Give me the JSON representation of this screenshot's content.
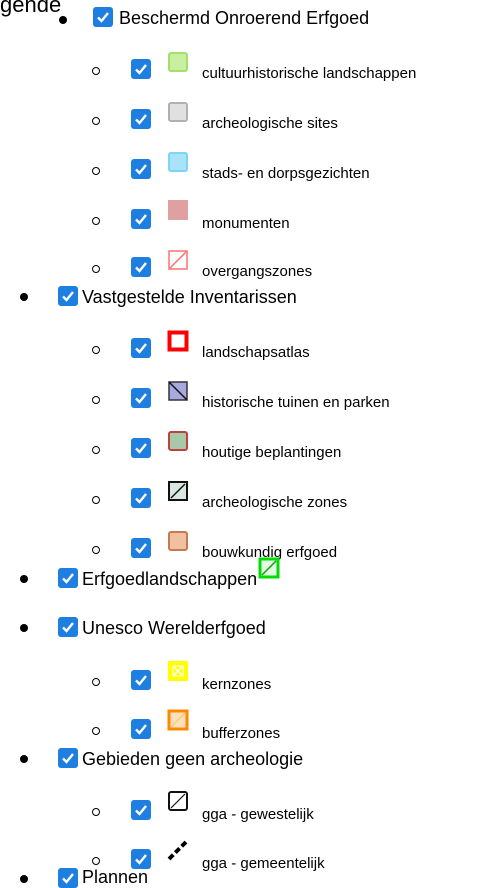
{
  "legend": {
    "title": "gende",
    "groups": [
      {
        "label": "Beschermd Onroerend Erfgoed",
        "checked": true,
        "items": [
          {
            "label": "cultuurhistorische landschappen",
            "checked": true,
            "icon": "light-green-square-icon"
          },
          {
            "label": "archeologische sites",
            "checked": true,
            "icon": "grey-square-icon"
          },
          {
            "label": "stads- en dorpsgezichten",
            "checked": true,
            "icon": "light-blue-square-icon"
          },
          {
            "label": "monumenten",
            "checked": true,
            "icon": "pink-square-icon"
          },
          {
            "label": "overgangszones",
            "checked": true,
            "icon": "red-hatched-square-icon"
          }
        ]
      },
      {
        "label": "Vastgestelde Inventarissen",
        "checked": true,
        "items": [
          {
            "label": "landschapsatlas",
            "checked": true,
            "icon": "red-outline-square-icon"
          },
          {
            "label": "historische tuinen en parken",
            "checked": true,
            "icon": "purple-hatched-square-icon"
          },
          {
            "label": "houtige beplantingen",
            "checked": true,
            "icon": "green-red-square-icon"
          },
          {
            "label": "archeologische zones",
            "checked": true,
            "icon": "black-hatched-square-icon"
          },
          {
            "label": "bouwkundig erfgoed",
            "checked": true,
            "icon": "orange-square-icon"
          }
        ]
      },
      {
        "label": "Erfgoedlandschappen",
        "checked": true,
        "icon": "green-hatched-square-icon",
        "items": []
      },
      {
        "label": "Unesco Werelderfgoed",
        "checked": true,
        "items": [
          {
            "label": "kernzones",
            "checked": true,
            "icon": "yellow-cross-square-icon"
          },
          {
            "label": "bufferzones",
            "checked": true,
            "icon": "orange-hatched-square-icon"
          }
        ]
      },
      {
        "label": "Gebieden geen archeologie",
        "checked": true,
        "items": [
          {
            "label": "gga - gewestelijk",
            "checked": true,
            "icon": "black-hatched-outline-icon"
          },
          {
            "label": "gga - gemeentelijk",
            "checked": true,
            "icon": "black-dashed-line-icon"
          }
        ]
      },
      {
        "label": "Plannen",
        "checked": true,
        "items": []
      }
    ]
  },
  "colors": {
    "checkbox": "#1e7fe0",
    "light_green": "#a3e06a",
    "grey": "#c8c8c8",
    "light_blue": "#7fd4f5",
    "pink": "#dea0a0",
    "red": "#ff0000",
    "purple": "#a9a9e0",
    "green_fill": "#a7c9a8",
    "orange_fill": "#f0c0a0",
    "bright_green": "#00dd00",
    "yellow": "#ffff00",
    "orange": "#ff8800"
  }
}
